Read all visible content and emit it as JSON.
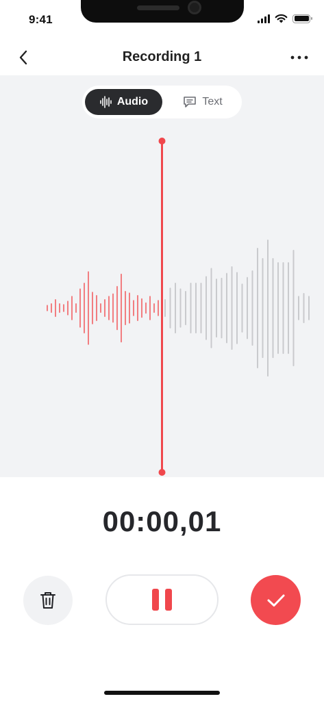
{
  "status_bar": {
    "time": "9:41"
  },
  "header": {
    "title": "Recording 1"
  },
  "segmented_control": {
    "audio_label": "Audio",
    "text_label": "Text",
    "selected": "Audio"
  },
  "timer": {
    "value": "00:00,01"
  },
  "colors": {
    "accent": "#f24a50",
    "played_wave": "#f27d80",
    "unplayed_wave": "#c9cacd",
    "panel_bg": "#f2f3f5",
    "dark_pill": "#2a2b2e"
  },
  "icons": {
    "back": "chevron-left-icon",
    "more": "more-horizontal-icon",
    "audio": "waveform-icon",
    "text": "chat-bubble-icon",
    "delete": "trash-icon",
    "pause": "pause-icon",
    "confirm": "check-icon"
  },
  "waveform": {
    "played_amplitudes": [
      0.06,
      0.1,
      0.2,
      0.1,
      0.08,
      0.16,
      0.28,
      0.1,
      0.46,
      0.6,
      0.88,
      0.38,
      0.3,
      0.1,
      0.2,
      0.28,
      0.34,
      0.52,
      0.82,
      0.4,
      0.36,
      0.18,
      0.3,
      0.22,
      0.12,
      0.28,
      0.1,
      0.18
    ],
    "unplayed_amplitudes": [
      0.2,
      0.48,
      0.6,
      0.46,
      0.4,
      0.6,
      0.6,
      0.6,
      0.76,
      0.96,
      0.7,
      0.72,
      0.84,
      1.0,
      0.86,
      0.58,
      0.74,
      0.9,
      1.45,
      1.2,
      1.65,
      1.2,
      1.1,
      1.1,
      1.1,
      1.4,
      0.28,
      0.35,
      0.28
    ]
  }
}
